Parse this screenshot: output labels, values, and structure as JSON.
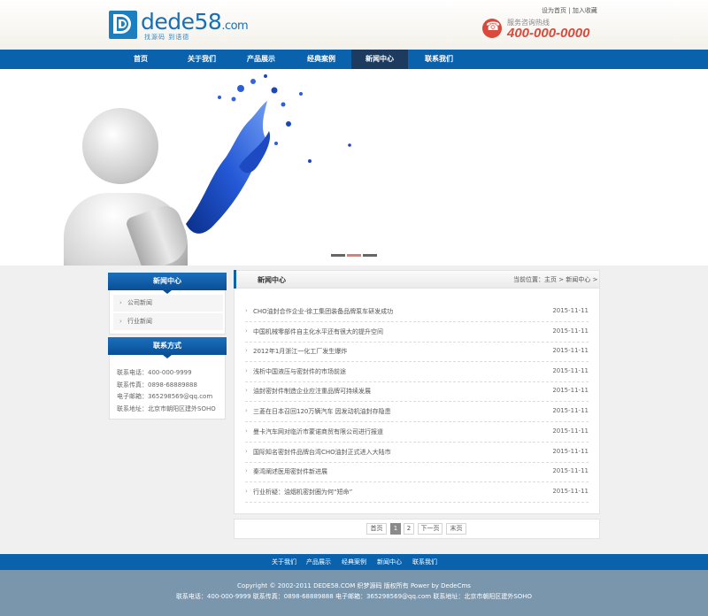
{
  "header": {
    "logo_text": "dede58",
    "logo_suffix": ".com",
    "logo_slogan": "找源码 到语德",
    "top_links": [
      "设为首页",
      "加入收藏"
    ],
    "top_link_sep": "|",
    "hotline_label": "服务咨询热线",
    "hotline_number": "400-000-0000"
  },
  "nav": {
    "items": [
      "首页",
      "关于我们",
      "产品展示",
      "经典案例",
      "新闻中心",
      "联系我们"
    ],
    "active": "新闻中心"
  },
  "banner": {
    "slides": 3,
    "active_slide": 2
  },
  "sidebar": {
    "news_title": "新闻中心",
    "news_items": [
      "公司新闻",
      "行业新闻"
    ],
    "contact_title": "联系方式",
    "contact_lines": [
      "联系电话：400-000-9999",
      "联系传真：0898-68889888",
      "电子邮箱：365298569@qq.com",
      "联系地址：北京市朝阳区建外SOHO"
    ]
  },
  "main": {
    "title": "新闻中心",
    "breadcrumb_prefix": "当前位置：",
    "breadcrumb": [
      "主页",
      "新闻中心"
    ],
    "breadcrumb_sep": ">",
    "news": [
      {
        "title": "CHO油封合作企业-徐工集团装备品牌泵车研发成功",
        "date": "2015-11-11"
      },
      {
        "title": "中国机械零部件自主化水平还有很大的提升空间",
        "date": "2015-11-11"
      },
      {
        "title": "2012年1月浙江一化工厂发生爆炸",
        "date": "2015-11-11"
      },
      {
        "title": "浅析中国液压与密封件的市场前途",
        "date": "2015-11-11"
      },
      {
        "title": "油封密封件制造企业应注重品牌可持续发展",
        "date": "2015-11-11"
      },
      {
        "title": "三菱在日本召回120万辆汽车 因发动机油封存隐患",
        "date": "2015-11-11"
      },
      {
        "title": "曼卡汽车网对临沂市蒙诺商贸有限公司进行报道",
        "date": "2015-11-11"
      },
      {
        "title": "国际知名密封件品牌台湾CHO油封正式进入大陆市",
        "date": "2015-11-11"
      },
      {
        "title": "秦湾阐述医用密封件新进展",
        "date": "2015-11-11"
      },
      {
        "title": "行业析疑：油烟机密封圈为何“短命”",
        "date": "2015-11-11"
      }
    ],
    "pager": [
      "首页",
      "1",
      "2",
      "下一页",
      "末页"
    ],
    "pager_current": "1"
  },
  "footer": {
    "links": [
      "关于我们",
      "产品展示",
      "经典案例",
      "新闻中心",
      "联系我们"
    ],
    "copyright": "Copyright © 2002-2011 DEDE58.COM 织梦源码 版权所有 Power by DedeCms",
    "contact": "联系电话：400-000-9999 联系传真：0898-68889888 电子邮箱：365298569@qq.com 联系地址：北京市朝阳区建外SOHO"
  },
  "colors": {
    "primary": "#0b62ac",
    "nav_active": "#1d3b5e",
    "hotline": "#d94a3c",
    "footer": "#7a96ad"
  }
}
